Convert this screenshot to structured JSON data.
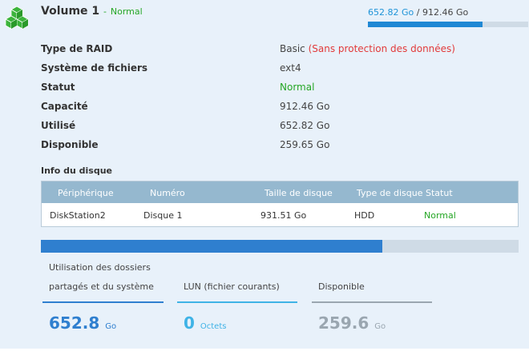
{
  "volume": {
    "title": "Volume 1",
    "separator": "-",
    "status": "Normal",
    "used": "652.82 Go",
    "usage_sep": "/",
    "total": "912.46 Go",
    "usage_fraction": 0.7155,
    "logo_icon": "green-cubes-icon"
  },
  "properties": [
    {
      "label": "Type de RAID",
      "value": "Basic",
      "extra": "(Sans protection des données)"
    },
    {
      "label": "Système de fichiers",
      "value": "ext4"
    },
    {
      "label": "Statut",
      "value": "Normal"
    },
    {
      "label": "Capacité",
      "value": "912.46 Go"
    },
    {
      "label": "Utilisé",
      "value": "652.82 Go"
    },
    {
      "label": "Disponible",
      "value": "259.65 Go"
    }
  ],
  "disk_info": {
    "title": "Info du disque",
    "headers": [
      "Périphérique",
      "Numéro",
      "Taille de disque",
      "Type de disque",
      "Statut"
    ],
    "rows": [
      [
        "DiskStation2",
        "Disque 1",
        "931.51 Go",
        "HDD",
        "Normal"
      ]
    ]
  },
  "breakdown": {
    "used_fraction": 0.715,
    "items": [
      {
        "label_line1": "Utilisation des dossiers",
        "label_line2": "partagés et du système",
        "value": "652.8",
        "unit": "Go",
        "color": "#2f7fcf"
      },
      {
        "label_line1": "",
        "label_line2": "LUN (fichier courants)",
        "value": "0",
        "unit": "Octets",
        "color": "#3fb3e6"
      },
      {
        "label_line1": "",
        "label_line2": "Disponible",
        "value": "259.6",
        "unit": "Go",
        "color": "#9aa6b0"
      }
    ]
  },
  "colors": {
    "status_green": "#25a625",
    "warning_red": "#e23a3a",
    "panel_bg": "#e8f1fa",
    "table_header": "#95b8cf"
  }
}
